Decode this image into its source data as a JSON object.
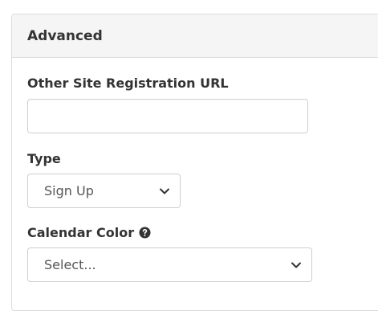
{
  "panel": {
    "title": "Advanced"
  },
  "fields": {
    "registration_url": {
      "label": "Other Site Registration URL",
      "value": "",
      "placeholder": ""
    },
    "type": {
      "label": "Type",
      "selected": "Sign Up"
    },
    "calendar_color": {
      "label": "Calendar Color",
      "selected": "Select...",
      "help_icon": "question-circle-icon"
    }
  }
}
